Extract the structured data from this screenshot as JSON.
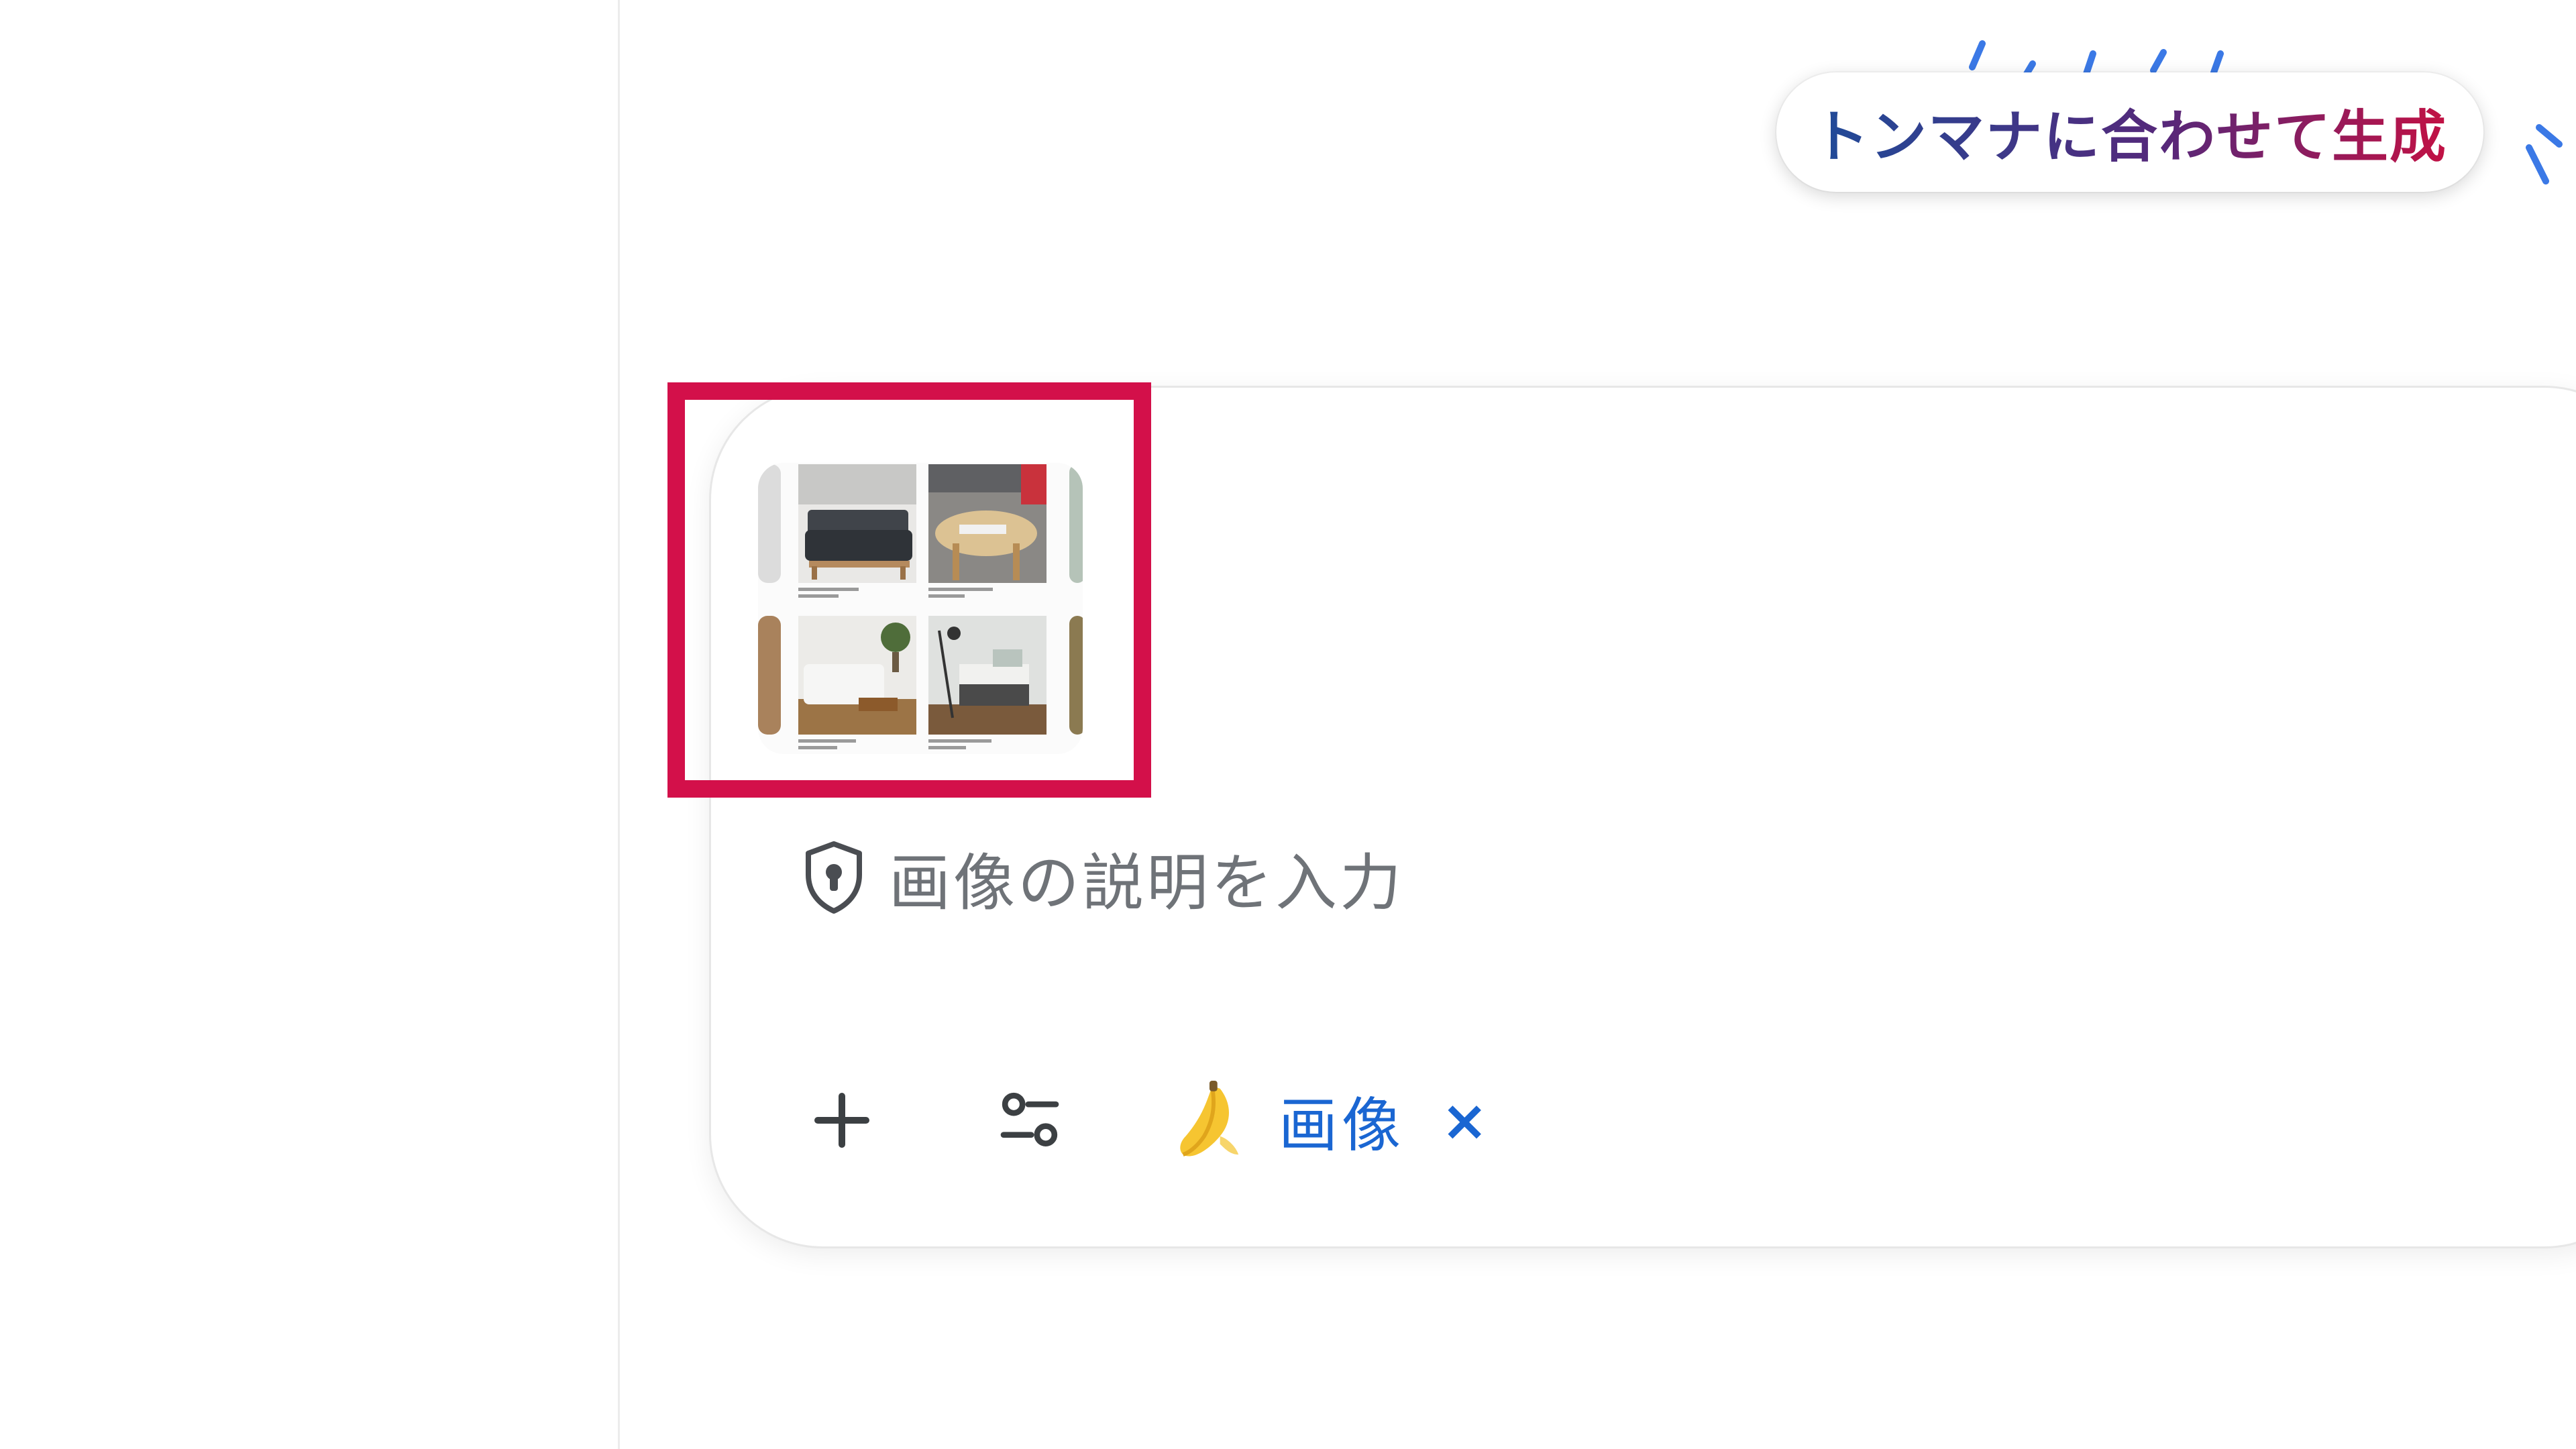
{
  "callout": {
    "text": "トンマナに合わせて生成"
  },
  "attachment": {
    "alt": "添付画像",
    "thumbnail_icon": "image-grid-thumbnail"
  },
  "prompt": {
    "placeholder": "画像の説明を入力",
    "icon": "shield-lock-icon"
  },
  "toolbar": {
    "add_icon": "plus-icon",
    "tools_icon": "tune-icon",
    "chip": {
      "icon": "banana-icon",
      "label": "画像",
      "close": "×"
    }
  },
  "colors": {
    "highlight": "#d3104a",
    "chip_text": "#1a66d2",
    "placeholder_text": "#6f7378",
    "callout_gradient": [
      "#1f4b99",
      "#55287a",
      "#c21144"
    ],
    "deco_strokes": "#3b79e6"
  }
}
